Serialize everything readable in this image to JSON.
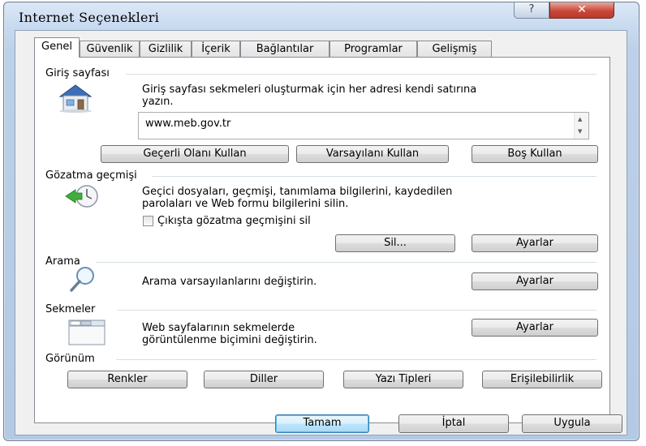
{
  "window": {
    "title": "Internet Seçenekleri",
    "help_label": "?",
    "close_label": "✕"
  },
  "tabs": [
    {
      "label": "Genel",
      "active": true
    },
    {
      "label": "Güvenlik"
    },
    {
      "label": "Gizlilik"
    },
    {
      "label": "İçerik"
    },
    {
      "label": "Bağlantılar"
    },
    {
      "label": "Programlar"
    },
    {
      "label": "Gelişmiş"
    }
  ],
  "home": {
    "heading": "Giriş sayfası",
    "desc_line1": "Giriş sayfası sekmeleri oluşturmak için her adresi kendi satırına",
    "desc_line2": "yazın.",
    "value": "www.meb.gov.tr",
    "use_current": "Geçerli Olanı Kullan",
    "use_default": "Varsayılanı Kullan",
    "use_blank": "Boş Kullan",
    "icon": "house-icon"
  },
  "history": {
    "heading": "Gözatma geçmişi",
    "desc_line1": "Geçici dosyaları, geçmişi, tanımlama bilgilerini, kaydedilen",
    "desc_line2": "parolaları ve Web formu bilgilerini silin.",
    "checkbox_label": "Çıkışta gözatma geçmişini sil",
    "checked": false,
    "delete_label": "Sil...",
    "settings_label": "Ayarlar",
    "icon": "history-clock-icon"
  },
  "search": {
    "heading": "Arama",
    "desc": "Arama varsayılanlarını değiştirin.",
    "settings_label": "Ayarlar",
    "icon": "magnifier-icon"
  },
  "tabs_section": {
    "heading": "Sekmeler",
    "desc_line1": "Web sayfalarının sekmelerde",
    "desc_line2": "görüntülenme biçimini değiştirin.",
    "settings_label": "Ayarlar",
    "icon": "tabbed-window-icon"
  },
  "appearance": {
    "heading": "Görünüm",
    "colors": "Renkler",
    "languages": "Diller",
    "fonts": "Yazı Tipleri",
    "accessibility": "Erişilebilirlik"
  },
  "footer": {
    "ok": "Tamam",
    "cancel": "İptal",
    "apply": "Uygula"
  },
  "colors": {
    "title_bar": "#c9dbf0",
    "close_button": "#c9483a",
    "panel_bg": "#ffffff",
    "default_button": "#bee6fd"
  }
}
